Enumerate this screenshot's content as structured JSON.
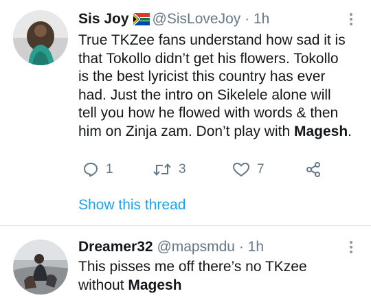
{
  "tweets": [
    {
      "author": "Sis Joy",
      "flag_icon": "south-africa-flag-icon",
      "handle": "@SisLoveJoy",
      "separator": "·",
      "time": "1h",
      "text_lines": [
        "True TKZee fans understand how sad it is",
        "that Tokollo didn’t get his flowers. Tokollo",
        "is the best lyricist this country has ever",
        "had. Just the intro on Sikelele alone will",
        "tell you how he flowed with words & then",
        "him on Zinja zam. Don’t play with "
      ],
      "text_bold_end": "Magesh",
      "text_tail": ".",
      "replies": "1",
      "retweets": "3",
      "likes": "7",
      "show_thread": "Show this thread"
    },
    {
      "author": "Dreamer32",
      "handle": "@mapsmdu",
      "separator": "·",
      "time": "1h",
      "text_lines": [
        "This pisses me off there’s no TKzee",
        "without "
      ],
      "text_bold_end": "Magesh",
      "text_tail": ""
    }
  ],
  "colors": {
    "link": "#1da1f2",
    "secondary_text": "#657786",
    "divider": "#e1e8ed"
  }
}
